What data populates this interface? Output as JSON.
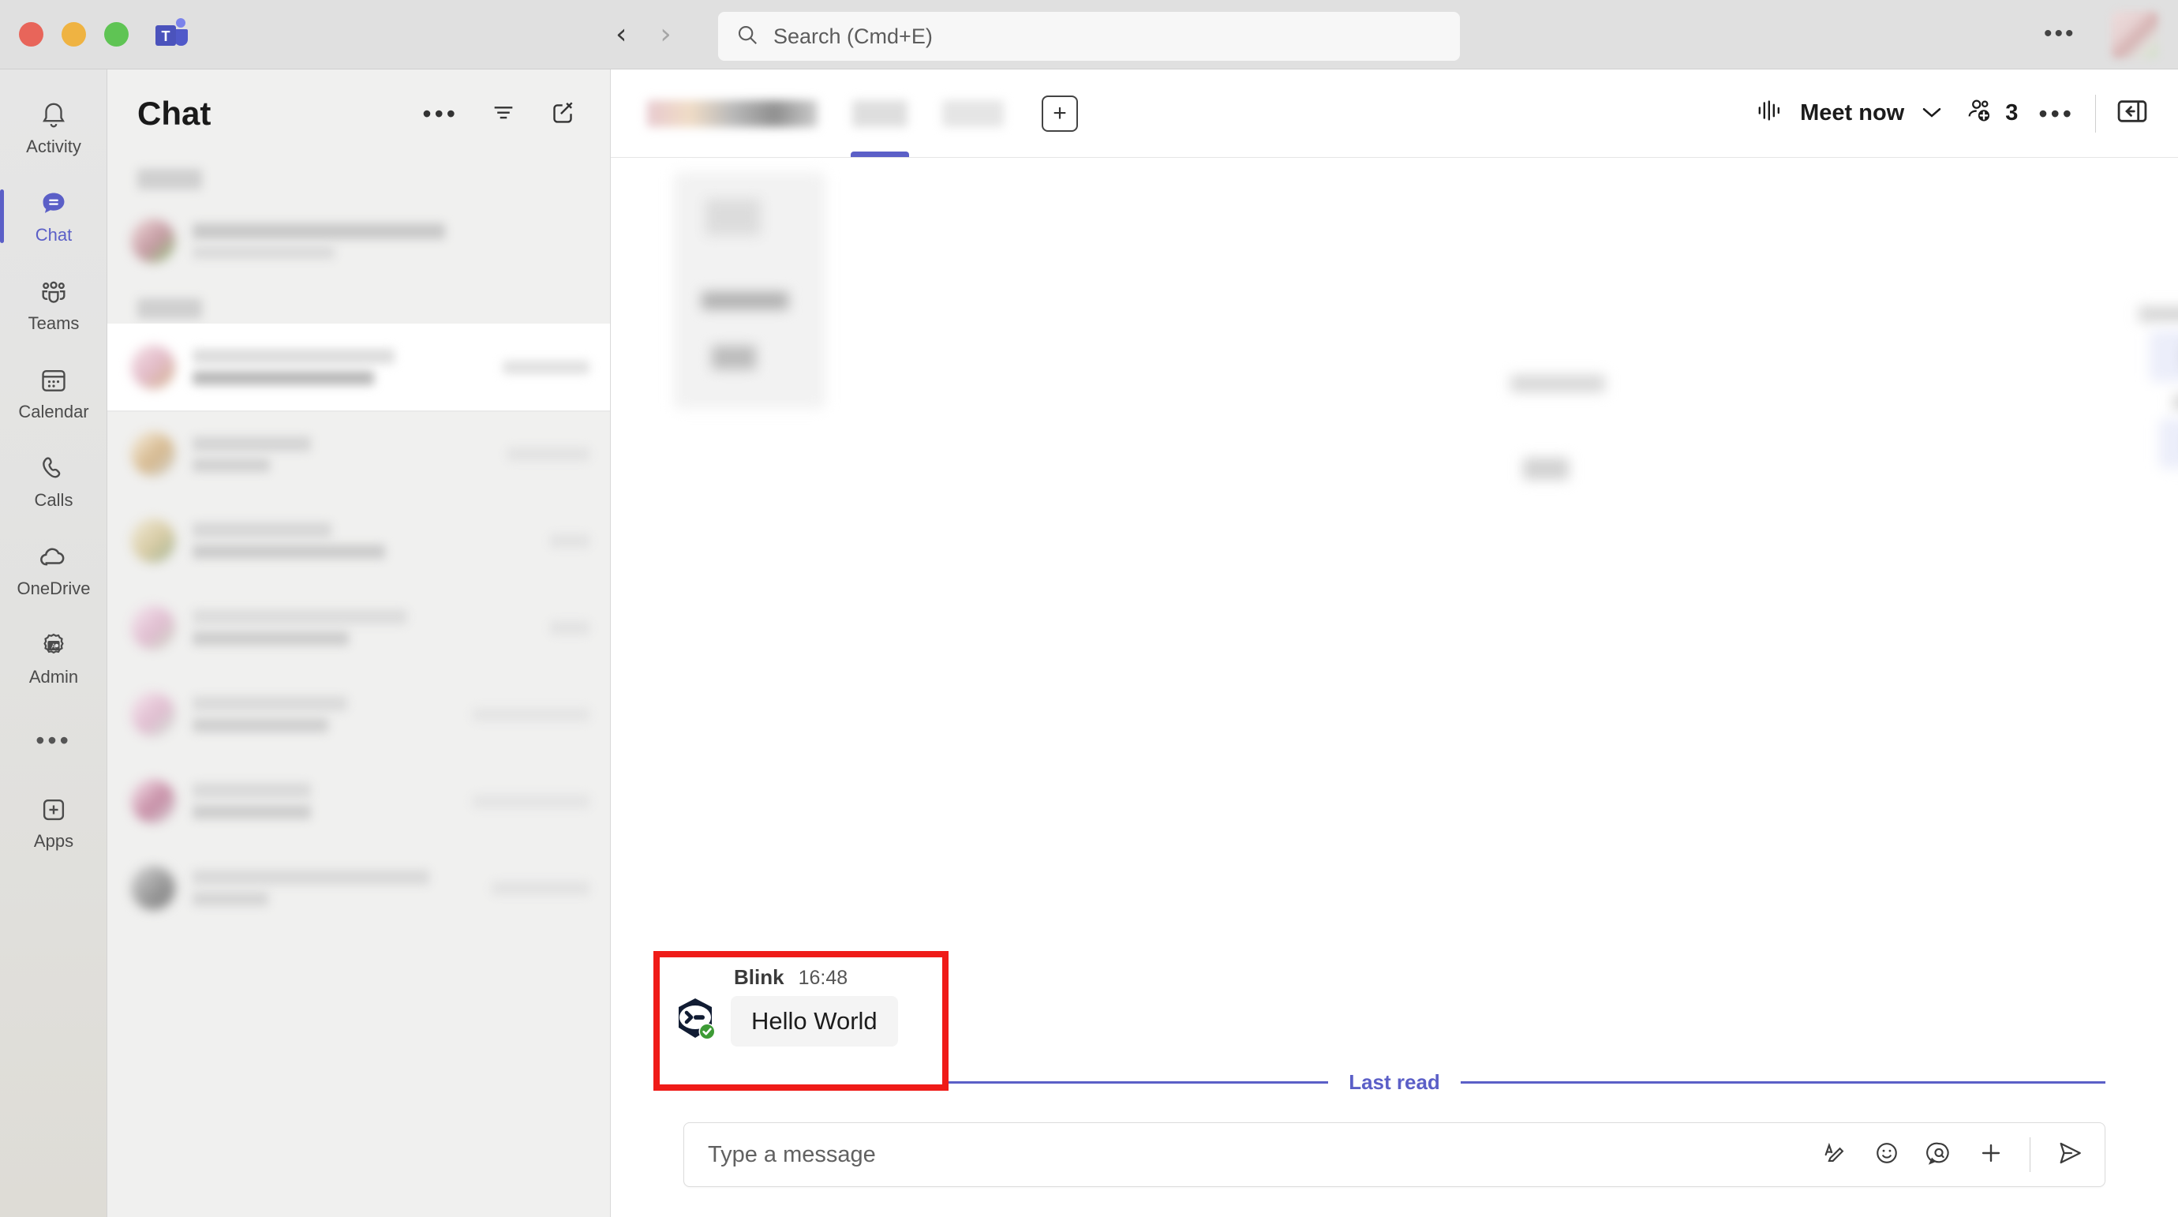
{
  "window": {
    "app_logo": "teams-logo",
    "traffic_lights": [
      "close",
      "minimize",
      "zoom"
    ],
    "back_label": "‹",
    "forward_label": "›",
    "more_label": "•••"
  },
  "search": {
    "placeholder": "Search (Cmd+E)",
    "icon": "search-icon"
  },
  "rail": {
    "items": [
      {
        "label": "Activity",
        "icon": "bell-icon",
        "active": false
      },
      {
        "label": "Chat",
        "icon": "chat-bubble-icon",
        "active": true
      },
      {
        "label": "Teams",
        "icon": "people-icon",
        "active": false
      },
      {
        "label": "Calendar",
        "icon": "calendar-icon",
        "active": false
      },
      {
        "label": "Calls",
        "icon": "phone-icon",
        "active": false
      },
      {
        "label": "OneDrive",
        "icon": "cloud-icon",
        "active": false
      },
      {
        "label": "Admin",
        "icon": "admin-gear-icon",
        "active": false
      }
    ],
    "overflow_label": "•••",
    "apps": {
      "label": "Apps",
      "icon": "plus-square-icon"
    }
  },
  "chat_panel": {
    "title": "Chat",
    "actions": [
      {
        "name": "more-options",
        "label": "•••"
      },
      {
        "name": "filter",
        "label": "filter-icon"
      },
      {
        "name": "compose-new-chat",
        "label": "compose-icon"
      }
    ],
    "groups": [
      {
        "redacted": true,
        "rows": 1
      },
      {
        "redacted": true,
        "rows": 8
      }
    ],
    "redacted_note": "chat list entries are blurred"
  },
  "conversation": {
    "tabs": [
      {
        "label": "",
        "redacted": true,
        "active": false
      },
      {
        "label": "",
        "redacted": true,
        "active": true
      },
      {
        "label": "",
        "redacted": true,
        "active": false
      }
    ],
    "add_tab_label": "+",
    "meet_now_label": "Meet now",
    "meet_now_chevron": "⌄",
    "participants_count": "3",
    "more_label": "•••",
    "collapse_label": "collapse-panel-icon",
    "last_read_label": "Last read"
  },
  "bot_message": {
    "author": "Blink",
    "time": "16:48",
    "text": "Hello World",
    "avatar_icon": "bot-terminal-avatar",
    "verified_badge": "green-check-icon",
    "highlight_color": "#ef1b18"
  },
  "compose": {
    "placeholder": "Type a message",
    "actions": [
      {
        "name": "format-text",
        "icon": "format-icon"
      },
      {
        "name": "emoji",
        "icon": "emoji-icon"
      },
      {
        "name": "giphy",
        "icon": "giphy-icon"
      },
      {
        "name": "attach-more",
        "icon": "plus-icon"
      },
      {
        "name": "send",
        "icon": "send-icon"
      }
    ]
  },
  "colors": {
    "accent": "#5b5fc7",
    "highlight": "#ef1b18",
    "chrome_bg": "#e0e0e0",
    "list_bg": "#f0f0ef",
    "outgoing_bubble": "#eceefa",
    "incoming_bubble": "#f4f4f4"
  }
}
